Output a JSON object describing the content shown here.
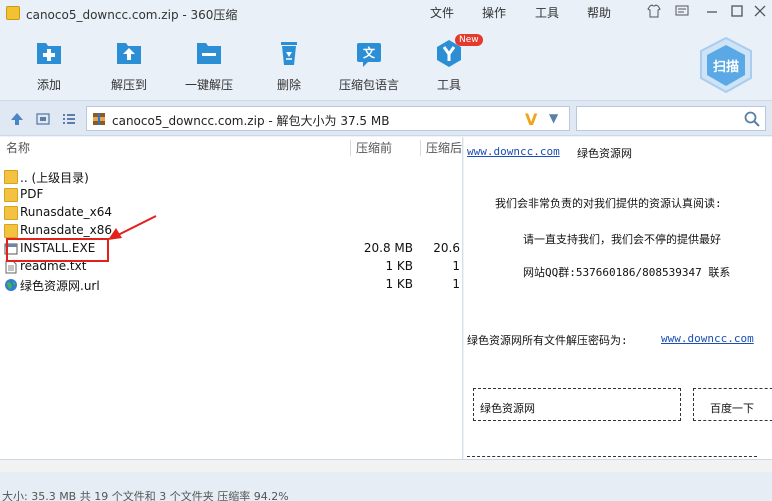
{
  "window": {
    "title": "canoco5_downcc.com.zip - 360压缩",
    "menus": [
      "文件",
      "操作",
      "工具",
      "帮助"
    ]
  },
  "toolbar": {
    "items": [
      {
        "label": "添加",
        "icon": "add-icon"
      },
      {
        "label": "解压到",
        "icon": "extract-to-icon"
      },
      {
        "label": "一键解压",
        "icon": "one-click-extract-icon"
      },
      {
        "label": "删除",
        "icon": "recycle-bin-icon"
      },
      {
        "label": "压缩包语言",
        "icon": "language-icon"
      },
      {
        "label": "工具",
        "icon": "tools-icon",
        "badge": "New"
      }
    ],
    "scan_label": "扫描"
  },
  "address": {
    "path": "canoco5_downcc.com.zip - 解包大小为 37.5 MB",
    "search_placeholder": ""
  },
  "filelist": {
    "columns": [
      "名称",
      "压缩前",
      "压缩后"
    ],
    "rows": [
      {
        "name": ".. (上级目录)",
        "size": "",
        "csize": "",
        "type": "folder"
      },
      {
        "name": "PDF",
        "size": "",
        "csize": "",
        "type": "folder"
      },
      {
        "name": "Runasdate_x64",
        "size": "",
        "csize": "",
        "type": "folder"
      },
      {
        "name": "Runasdate_x86",
        "size": "",
        "csize": "",
        "type": "folder"
      },
      {
        "name": "INSTALL.EXE",
        "size": "20.8 MB",
        "csize": "20.6",
        "type": "exe"
      },
      {
        "name": "readme.txt",
        "size": "1 KB",
        "csize": "1",
        "type": "txt"
      },
      {
        "name": "绿色资源网.url",
        "size": "1 KB",
        "csize": "1",
        "type": "url"
      }
    ]
  },
  "preview": {
    "link1": "www.downcc.com",
    "site_name": "绿色资源网",
    "line1": "我们会非常负责的对我们提供的资源认真阅读:",
    "line2": "请一直支持我们，我们会不停的提供最好",
    "line3": "网站QQ群:537660186/808539347  联系",
    "line4": "绿色资源网所有文件解压密码为:",
    "link2": "www.downcc.com",
    "box1": "绿色资源网",
    "box2": "百度一下"
  },
  "status": {
    "text": "大小: 35.3 MB 共 19 个文件和 3 个文件夹 压缩率 94.2%"
  },
  "colors": {
    "accent": "#2c8fd6",
    "highlight": "#e3201b",
    "badge": "#e23b2e"
  }
}
